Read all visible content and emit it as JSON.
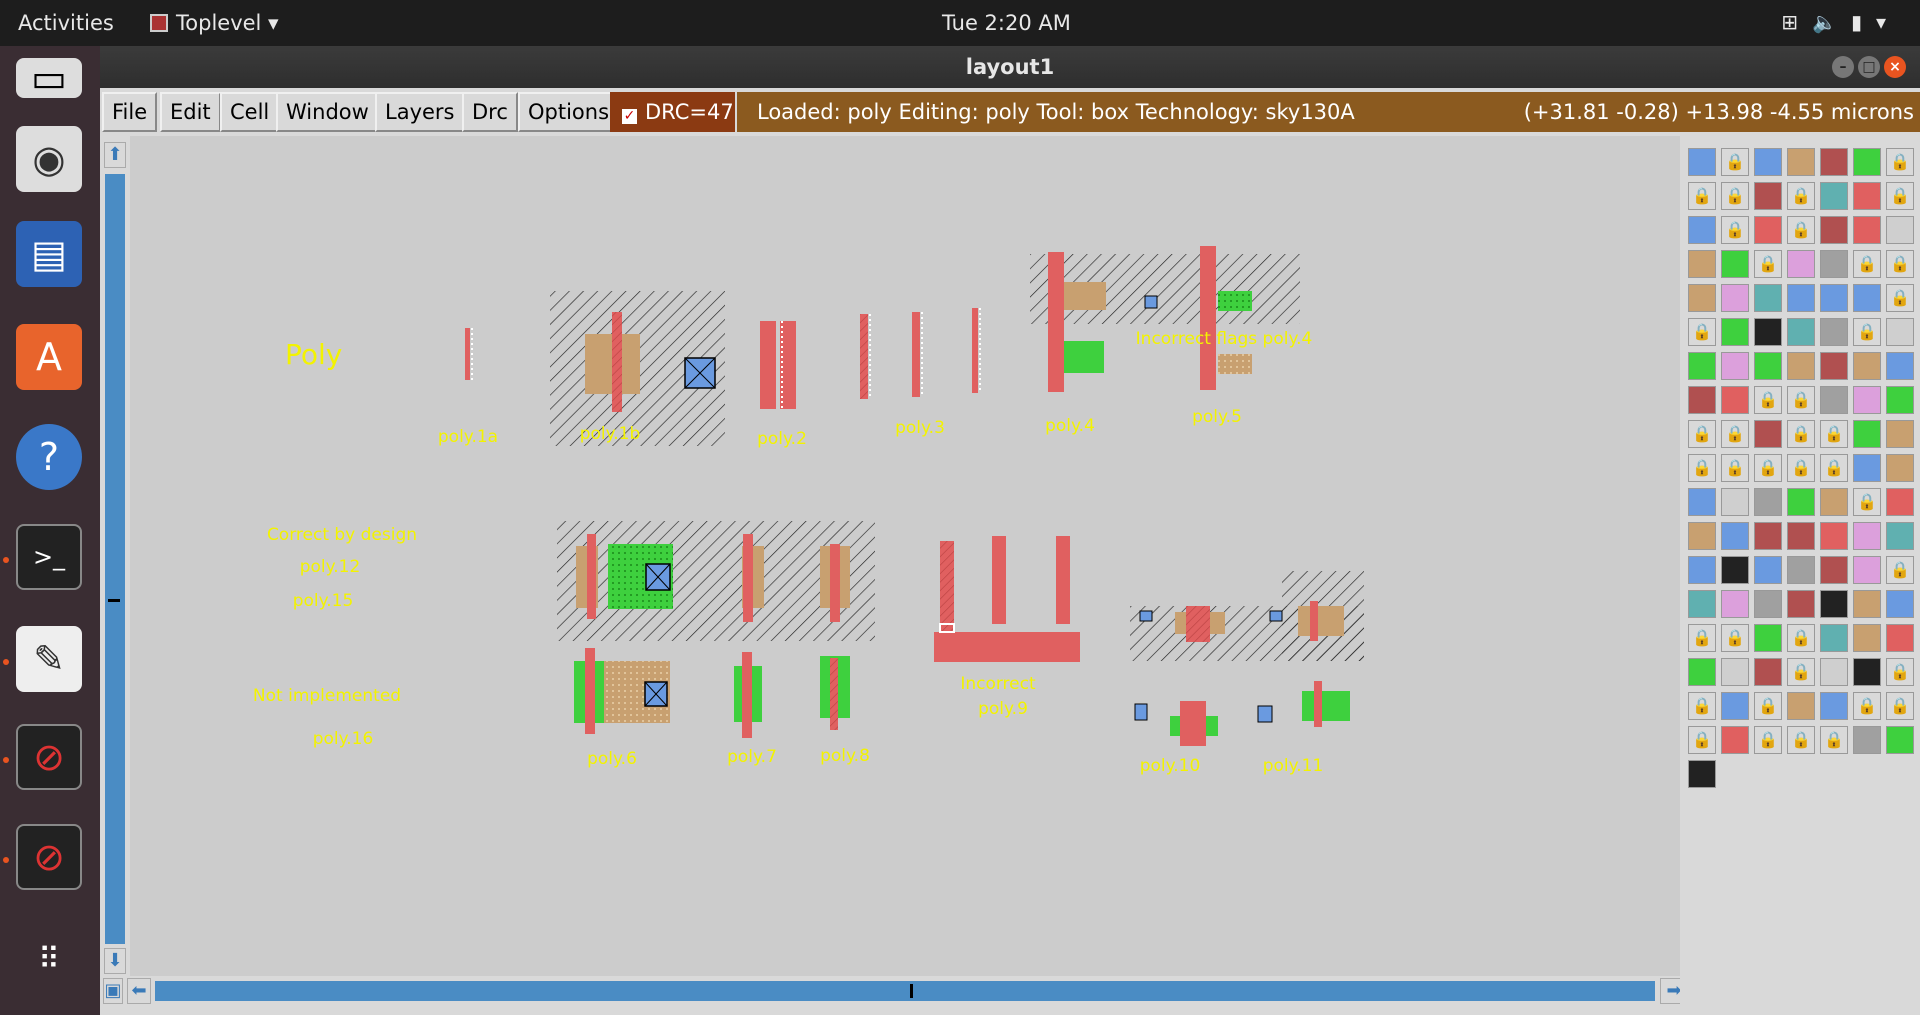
{
  "topbar": {
    "activities": "Activities",
    "app_name": "Toplevel",
    "clock": "Tue  2:20 AM"
  },
  "window": {
    "title": "layout1"
  },
  "menu": [
    "File",
    "Edit",
    "Cell",
    "Window",
    "Layers",
    "Drc",
    "Options"
  ],
  "drc": {
    "label": "DRC=47",
    "checked": true
  },
  "status": {
    "message": "Loaded: poly Editing: poly Tool: box  Technology: sky130A",
    "coords": "(+31.81 -0.28) +13.98 -4.55 microns"
  },
  "labels": {
    "title": "Poly",
    "correct_by_design": "Correct  by  design",
    "poly12": "poly.12",
    "poly15": "poly.15",
    "not_implemented": "Not implemented",
    "poly16": "poly.16",
    "poly1a": "poly.1a",
    "poly1b": "poly.1b",
    "poly2": "poly.2",
    "poly3": "poly.3",
    "poly4": "poly.4",
    "poly5": "poly.5",
    "incorrect_flags": "Incorrect  flags  poly.4",
    "poly6": "poly.6",
    "poly7": "poly.7",
    "poly8": "poly.8",
    "incorrect": "Incorrect",
    "poly9": "poly.9",
    "poly10": "poly.10",
    "poly11": "poly.11"
  },
  "colors": {
    "poly": "#e06060",
    "diff": "#c8a070",
    "green": "#3ed03e",
    "contact": "#6a9ae0",
    "label": "#f3f300"
  }
}
